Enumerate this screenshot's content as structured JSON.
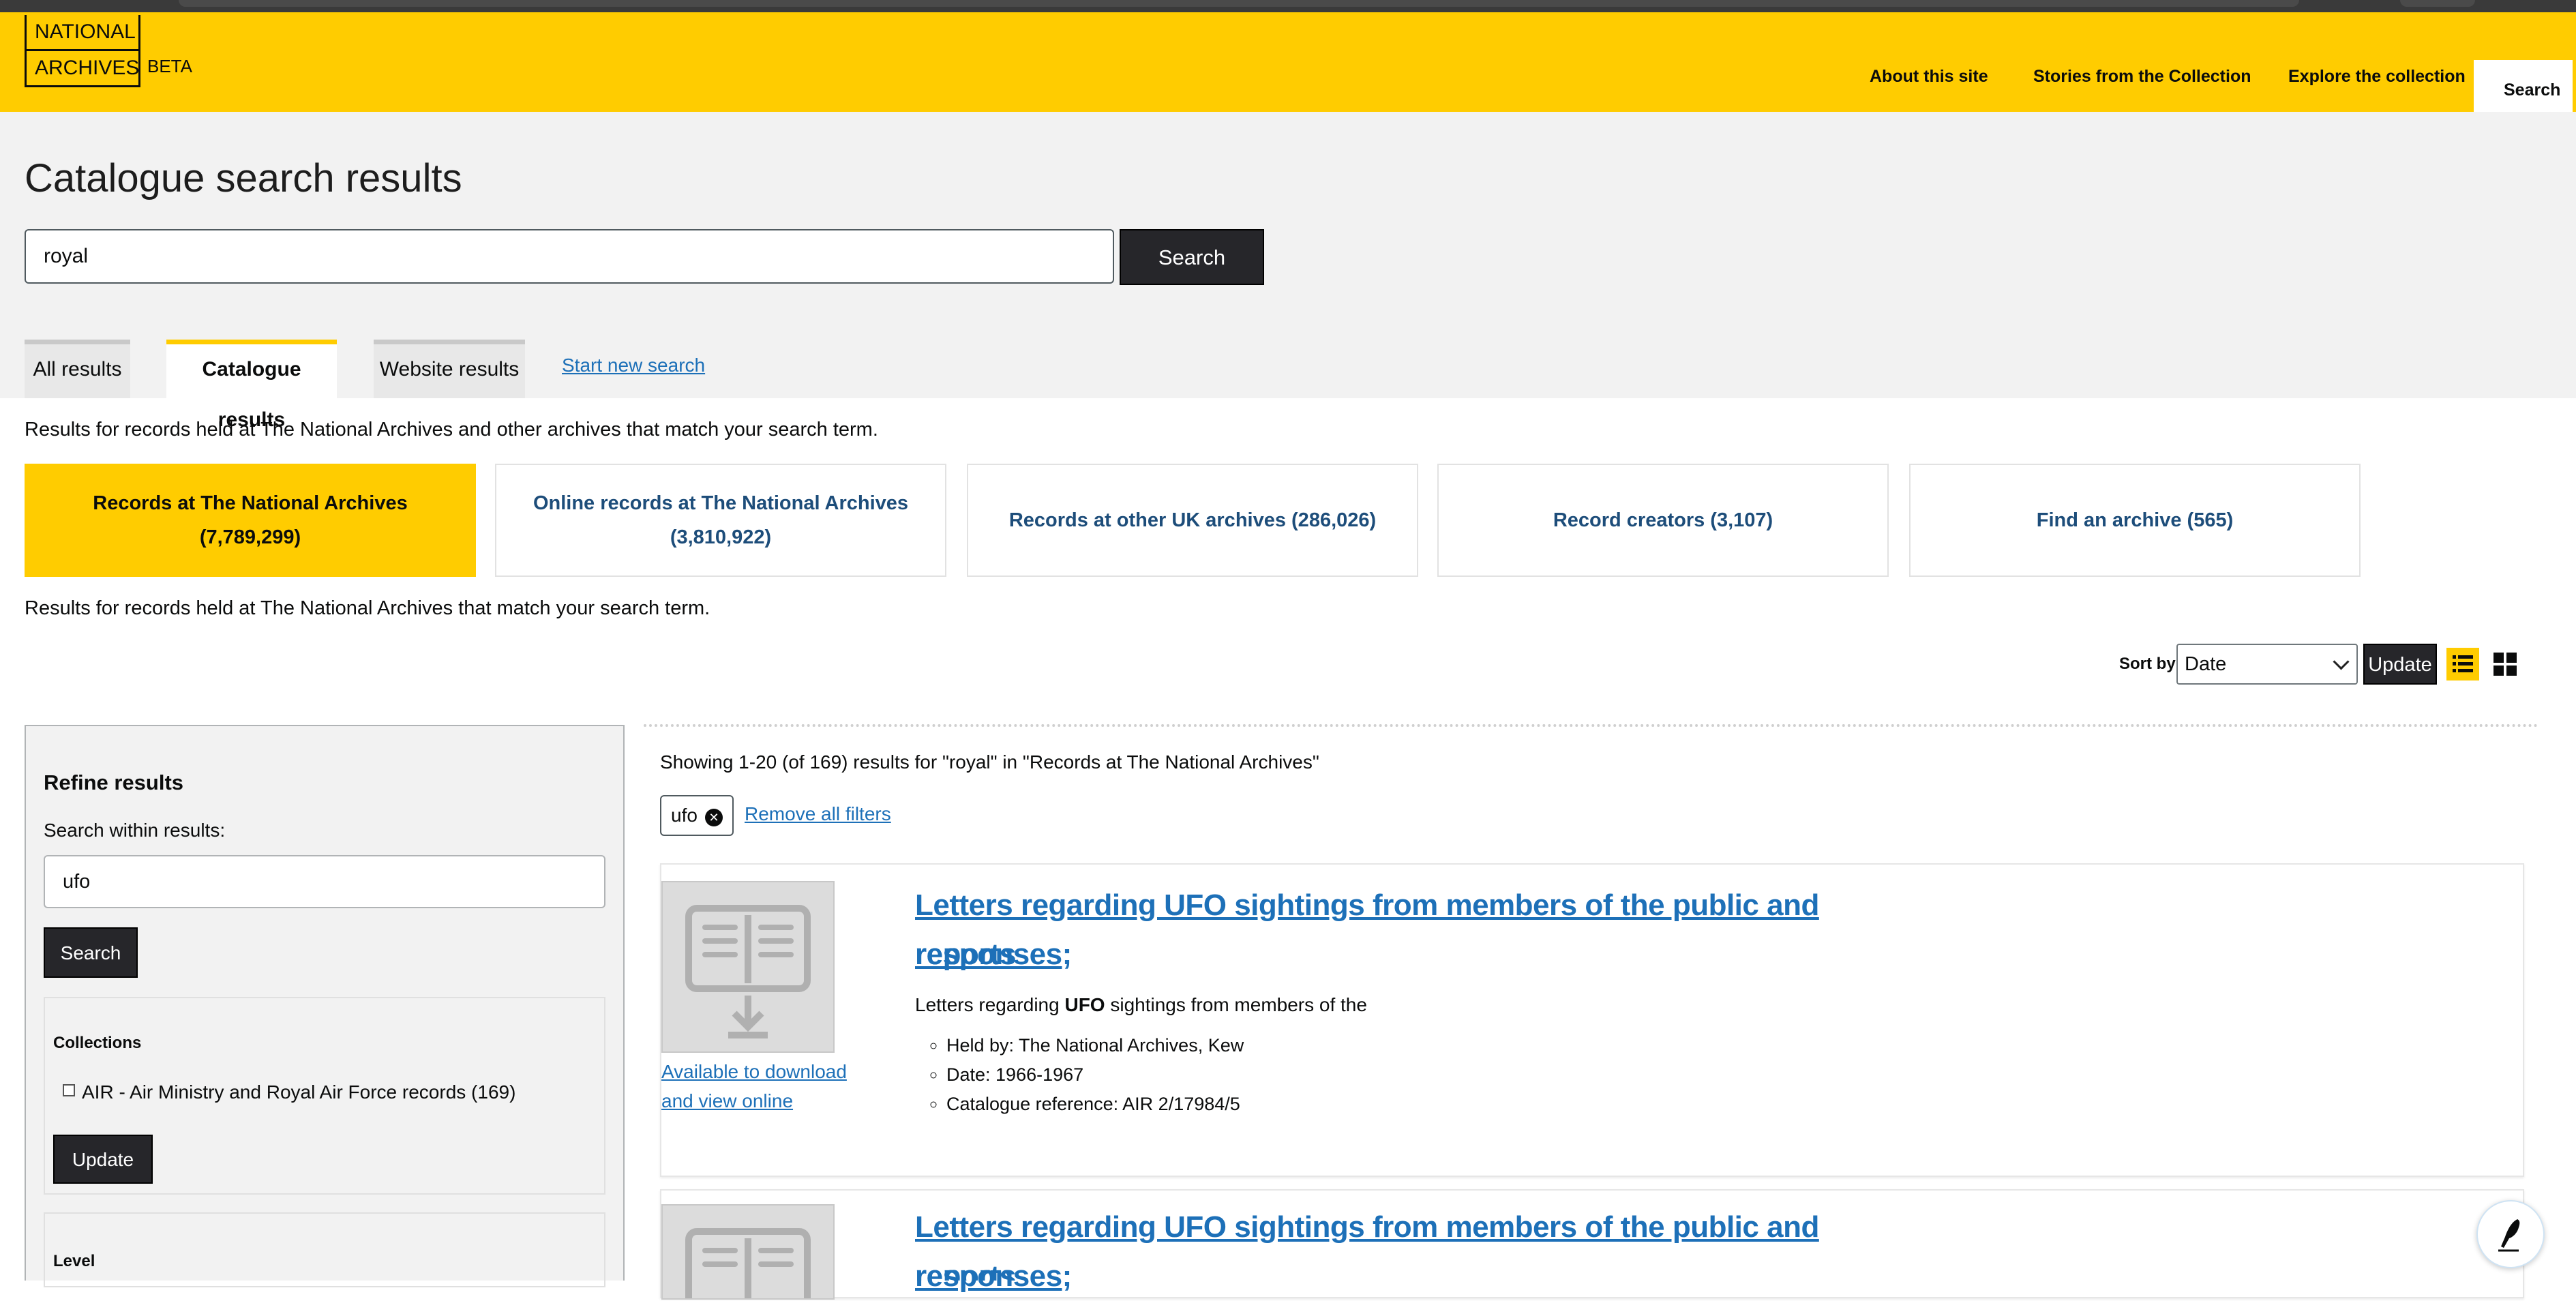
{
  "brand": {
    "line1": "NATIONAL",
    "line2": "ARCHIVES",
    "badge": "BETA"
  },
  "nav": {
    "items": [
      "About this site",
      "Stories from the Collection",
      "Explore the collection",
      "Search"
    ]
  },
  "page": {
    "title": "Catalogue search results"
  },
  "search": {
    "value": "royal",
    "button": "Search"
  },
  "tabs": [
    "All results",
    "Catalogue results",
    "Website results"
  ],
  "start_new": "Start new search",
  "intro_text": "Results for records held at The National Archives and other archives that match your search term.",
  "buckets": [
    "Records at The National Archives (7,789,299)",
    "Online records at The National Archives (3,810,922)",
    "Records at other UK archives (286,026)",
    "Record creators (3,107)",
    "Find an archive (565)"
  ],
  "bucket_text": "Results for records held at The National Archives that match your search term.",
  "sort": {
    "label": "Sort by",
    "value": "Date",
    "update": "Update"
  },
  "refine": {
    "heading": "Refine results",
    "within_label": "Search within results:",
    "within_value": "ufo",
    "search_button": "Search",
    "collections_heading": "Collections",
    "collection_option": "AIR - Air Ministry and Royal Air Force records (169)",
    "update_button": "Update",
    "level_heading": "Level"
  },
  "results": {
    "summary": "Showing 1-20 (of 169) results for \"royal\" in \"Records at The National Archives\"",
    "filter_chip": "ufo",
    "remove_filters": "Remove all filters",
    "items": [
      {
        "title_line1": "Letters regarding UFO sightings from members of the public and responses;",
        "title_line2": "reports",
        "availability": "Available to download and view online",
        "snippet_pre": "Letters regarding ",
        "snippet_bold": "UFO",
        "snippet_post": " sightings from members of the",
        "held_by": "Held by: The National Archives, Kew",
        "date": "Date: 1966-1967",
        "reference": "Catalogue reference: AIR 2/17984/5"
      },
      {
        "title_line1": "Letters regarding UFO sightings from members of the public and responses;",
        "title_line2": "reports"
      }
    ]
  },
  "colors": {
    "brand_yellow": "#ffcc00",
    "link": "#1d70b8",
    "button": "#26262a"
  },
  "icons": [
    "download-book-icon",
    "list-view-icon",
    "grid-view-icon",
    "remove-filter-icon",
    "chevron-down-icon",
    "assistant-icon"
  ]
}
